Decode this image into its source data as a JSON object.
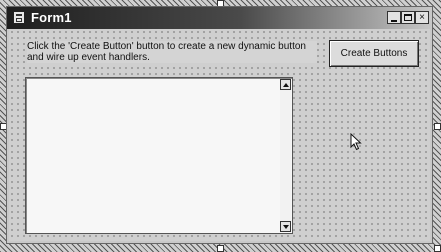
{
  "window": {
    "title": "Form1",
    "icon": "form-window-icon",
    "controls": {
      "close_label": "×"
    }
  },
  "main": {
    "instructions": "Click the 'Create Button' button to create a new dynamic button and wire up event handlers.",
    "create_button_label": "Create Buttons",
    "textbox_value": ""
  },
  "icons": [
    "form-window-icon",
    "minimize-icon",
    "maximize-icon",
    "close-icon",
    "scroll-up-arrow-icon",
    "scroll-down-arrow-icon",
    "mouse-pointer-icon"
  ]
}
